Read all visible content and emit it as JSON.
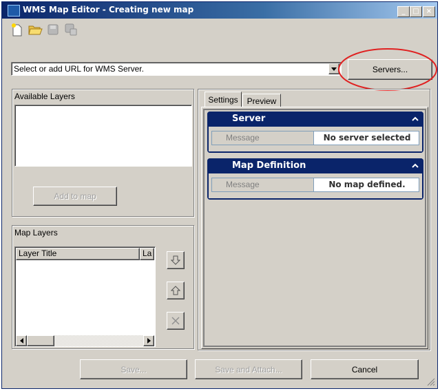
{
  "window": {
    "title": "WMS Map Editor - Creating new map"
  },
  "toolbar": {
    "icons": [
      "new-icon",
      "open-folder-icon",
      "save-icon",
      "save-as-icon"
    ]
  },
  "url_bar": {
    "value": "Select or add URL for WMS Server.",
    "servers_button": "Servers..."
  },
  "available_layers": {
    "label": "Available Layers",
    "add_button": "Add to map"
  },
  "map_layers": {
    "label": "Map Layers",
    "columns": [
      "Layer Title",
      "La"
    ]
  },
  "tabs": [
    "Settings",
    "Preview"
  ],
  "sections": {
    "server": {
      "title": "Server",
      "message_label": "Message",
      "message_value": "No server selected"
    },
    "map_definition": {
      "title": "Map Definition",
      "message_label": "Message",
      "message_value": "No map defined."
    }
  },
  "footer": {
    "save": "Save...",
    "save_attach": "Save and Attach...",
    "cancel": "Cancel"
  },
  "colors": {
    "accent": "#0a246a",
    "highlight_circle": "#e02020"
  }
}
